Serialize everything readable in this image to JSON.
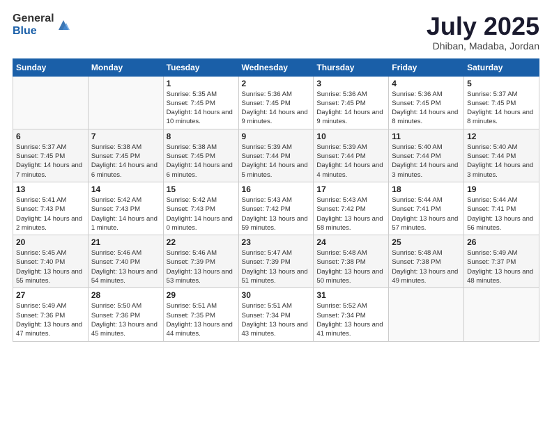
{
  "header": {
    "logo_general": "General",
    "logo_blue": "Blue",
    "month_title": "July 2025",
    "location": "Dhiban, Madaba, Jordan"
  },
  "days_of_week": [
    "Sunday",
    "Monday",
    "Tuesday",
    "Wednesday",
    "Thursday",
    "Friday",
    "Saturday"
  ],
  "weeks": [
    [
      {
        "day": "",
        "info": ""
      },
      {
        "day": "",
        "info": ""
      },
      {
        "day": "1",
        "info": "Sunrise: 5:35 AM\nSunset: 7:45 PM\nDaylight: 14 hours and 10 minutes."
      },
      {
        "day": "2",
        "info": "Sunrise: 5:36 AM\nSunset: 7:45 PM\nDaylight: 14 hours and 9 minutes."
      },
      {
        "day": "3",
        "info": "Sunrise: 5:36 AM\nSunset: 7:45 PM\nDaylight: 14 hours and 9 minutes."
      },
      {
        "day": "4",
        "info": "Sunrise: 5:36 AM\nSunset: 7:45 PM\nDaylight: 14 hours and 8 minutes."
      },
      {
        "day": "5",
        "info": "Sunrise: 5:37 AM\nSunset: 7:45 PM\nDaylight: 14 hours and 8 minutes."
      }
    ],
    [
      {
        "day": "6",
        "info": "Sunrise: 5:37 AM\nSunset: 7:45 PM\nDaylight: 14 hours and 7 minutes."
      },
      {
        "day": "7",
        "info": "Sunrise: 5:38 AM\nSunset: 7:45 PM\nDaylight: 14 hours and 6 minutes."
      },
      {
        "day": "8",
        "info": "Sunrise: 5:38 AM\nSunset: 7:45 PM\nDaylight: 14 hours and 6 minutes."
      },
      {
        "day": "9",
        "info": "Sunrise: 5:39 AM\nSunset: 7:44 PM\nDaylight: 14 hours and 5 minutes."
      },
      {
        "day": "10",
        "info": "Sunrise: 5:39 AM\nSunset: 7:44 PM\nDaylight: 14 hours and 4 minutes."
      },
      {
        "day": "11",
        "info": "Sunrise: 5:40 AM\nSunset: 7:44 PM\nDaylight: 14 hours and 3 minutes."
      },
      {
        "day": "12",
        "info": "Sunrise: 5:40 AM\nSunset: 7:44 PM\nDaylight: 14 hours and 3 minutes."
      }
    ],
    [
      {
        "day": "13",
        "info": "Sunrise: 5:41 AM\nSunset: 7:43 PM\nDaylight: 14 hours and 2 minutes."
      },
      {
        "day": "14",
        "info": "Sunrise: 5:42 AM\nSunset: 7:43 PM\nDaylight: 14 hours and 1 minute."
      },
      {
        "day": "15",
        "info": "Sunrise: 5:42 AM\nSunset: 7:43 PM\nDaylight: 14 hours and 0 minutes."
      },
      {
        "day": "16",
        "info": "Sunrise: 5:43 AM\nSunset: 7:42 PM\nDaylight: 13 hours and 59 minutes."
      },
      {
        "day": "17",
        "info": "Sunrise: 5:43 AM\nSunset: 7:42 PM\nDaylight: 13 hours and 58 minutes."
      },
      {
        "day": "18",
        "info": "Sunrise: 5:44 AM\nSunset: 7:41 PM\nDaylight: 13 hours and 57 minutes."
      },
      {
        "day": "19",
        "info": "Sunrise: 5:44 AM\nSunset: 7:41 PM\nDaylight: 13 hours and 56 minutes."
      }
    ],
    [
      {
        "day": "20",
        "info": "Sunrise: 5:45 AM\nSunset: 7:40 PM\nDaylight: 13 hours and 55 minutes."
      },
      {
        "day": "21",
        "info": "Sunrise: 5:46 AM\nSunset: 7:40 PM\nDaylight: 13 hours and 54 minutes."
      },
      {
        "day": "22",
        "info": "Sunrise: 5:46 AM\nSunset: 7:39 PM\nDaylight: 13 hours and 53 minutes."
      },
      {
        "day": "23",
        "info": "Sunrise: 5:47 AM\nSunset: 7:39 PM\nDaylight: 13 hours and 51 minutes."
      },
      {
        "day": "24",
        "info": "Sunrise: 5:48 AM\nSunset: 7:38 PM\nDaylight: 13 hours and 50 minutes."
      },
      {
        "day": "25",
        "info": "Sunrise: 5:48 AM\nSunset: 7:38 PM\nDaylight: 13 hours and 49 minutes."
      },
      {
        "day": "26",
        "info": "Sunrise: 5:49 AM\nSunset: 7:37 PM\nDaylight: 13 hours and 48 minutes."
      }
    ],
    [
      {
        "day": "27",
        "info": "Sunrise: 5:49 AM\nSunset: 7:36 PM\nDaylight: 13 hours and 47 minutes."
      },
      {
        "day": "28",
        "info": "Sunrise: 5:50 AM\nSunset: 7:36 PM\nDaylight: 13 hours and 45 minutes."
      },
      {
        "day": "29",
        "info": "Sunrise: 5:51 AM\nSunset: 7:35 PM\nDaylight: 13 hours and 44 minutes."
      },
      {
        "day": "30",
        "info": "Sunrise: 5:51 AM\nSunset: 7:34 PM\nDaylight: 13 hours and 43 minutes."
      },
      {
        "day": "31",
        "info": "Sunrise: 5:52 AM\nSunset: 7:34 PM\nDaylight: 13 hours and 41 minutes."
      },
      {
        "day": "",
        "info": ""
      },
      {
        "day": "",
        "info": ""
      }
    ]
  ]
}
